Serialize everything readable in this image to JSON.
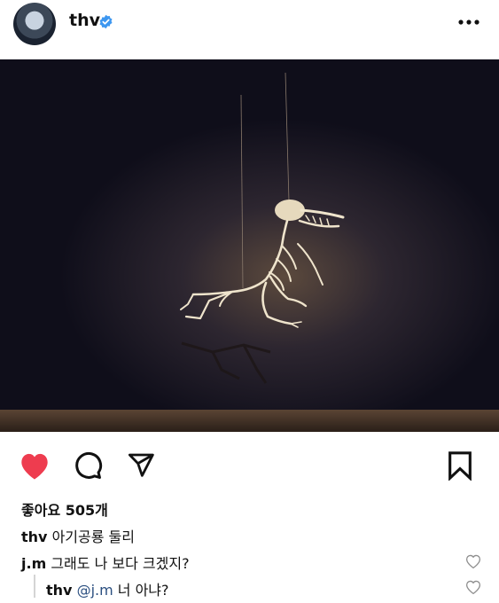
{
  "post": {
    "username": "thv",
    "likes_text": "좋아요 505개",
    "caption_user": "thv",
    "caption_text": "아기공룡 둘리"
  },
  "comments": [
    {
      "user": "j.m",
      "text": "그래도 나 보다 크겠지?"
    },
    {
      "user": "thv",
      "mention": "@j.m",
      "text": "너 아냐?"
    }
  ],
  "colors": {
    "like_red": "#ee3c4f",
    "verified_blue": "#3d97f0",
    "mention_blue": "#2b4f80"
  },
  "icons": [
    "verified-badge-icon",
    "more-options-icon",
    "heart-filled-icon",
    "comment-icon",
    "share-icon",
    "bookmark-icon",
    "heart-outline-icon"
  ]
}
